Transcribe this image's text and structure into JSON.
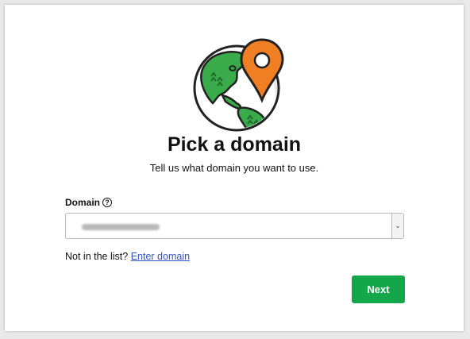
{
  "page": {
    "title": "Pick a domain",
    "subtitle": "Tell us what domain you want to use."
  },
  "domain_field": {
    "label": "Domain",
    "help_icon": "?",
    "selected_value": "",
    "arrow_glyph": "⌄"
  },
  "not_in_list": {
    "prefix": "Not in the list?",
    "link": "Enter domain"
  },
  "actions": {
    "next_label": "Next"
  },
  "colors": {
    "primary_button": "#14a64b",
    "link": "#2f54c7",
    "globe_land": "#3aab4b",
    "pin": "#f07e22"
  },
  "icons": {
    "hero": "globe-with-location-pin-icon"
  }
}
